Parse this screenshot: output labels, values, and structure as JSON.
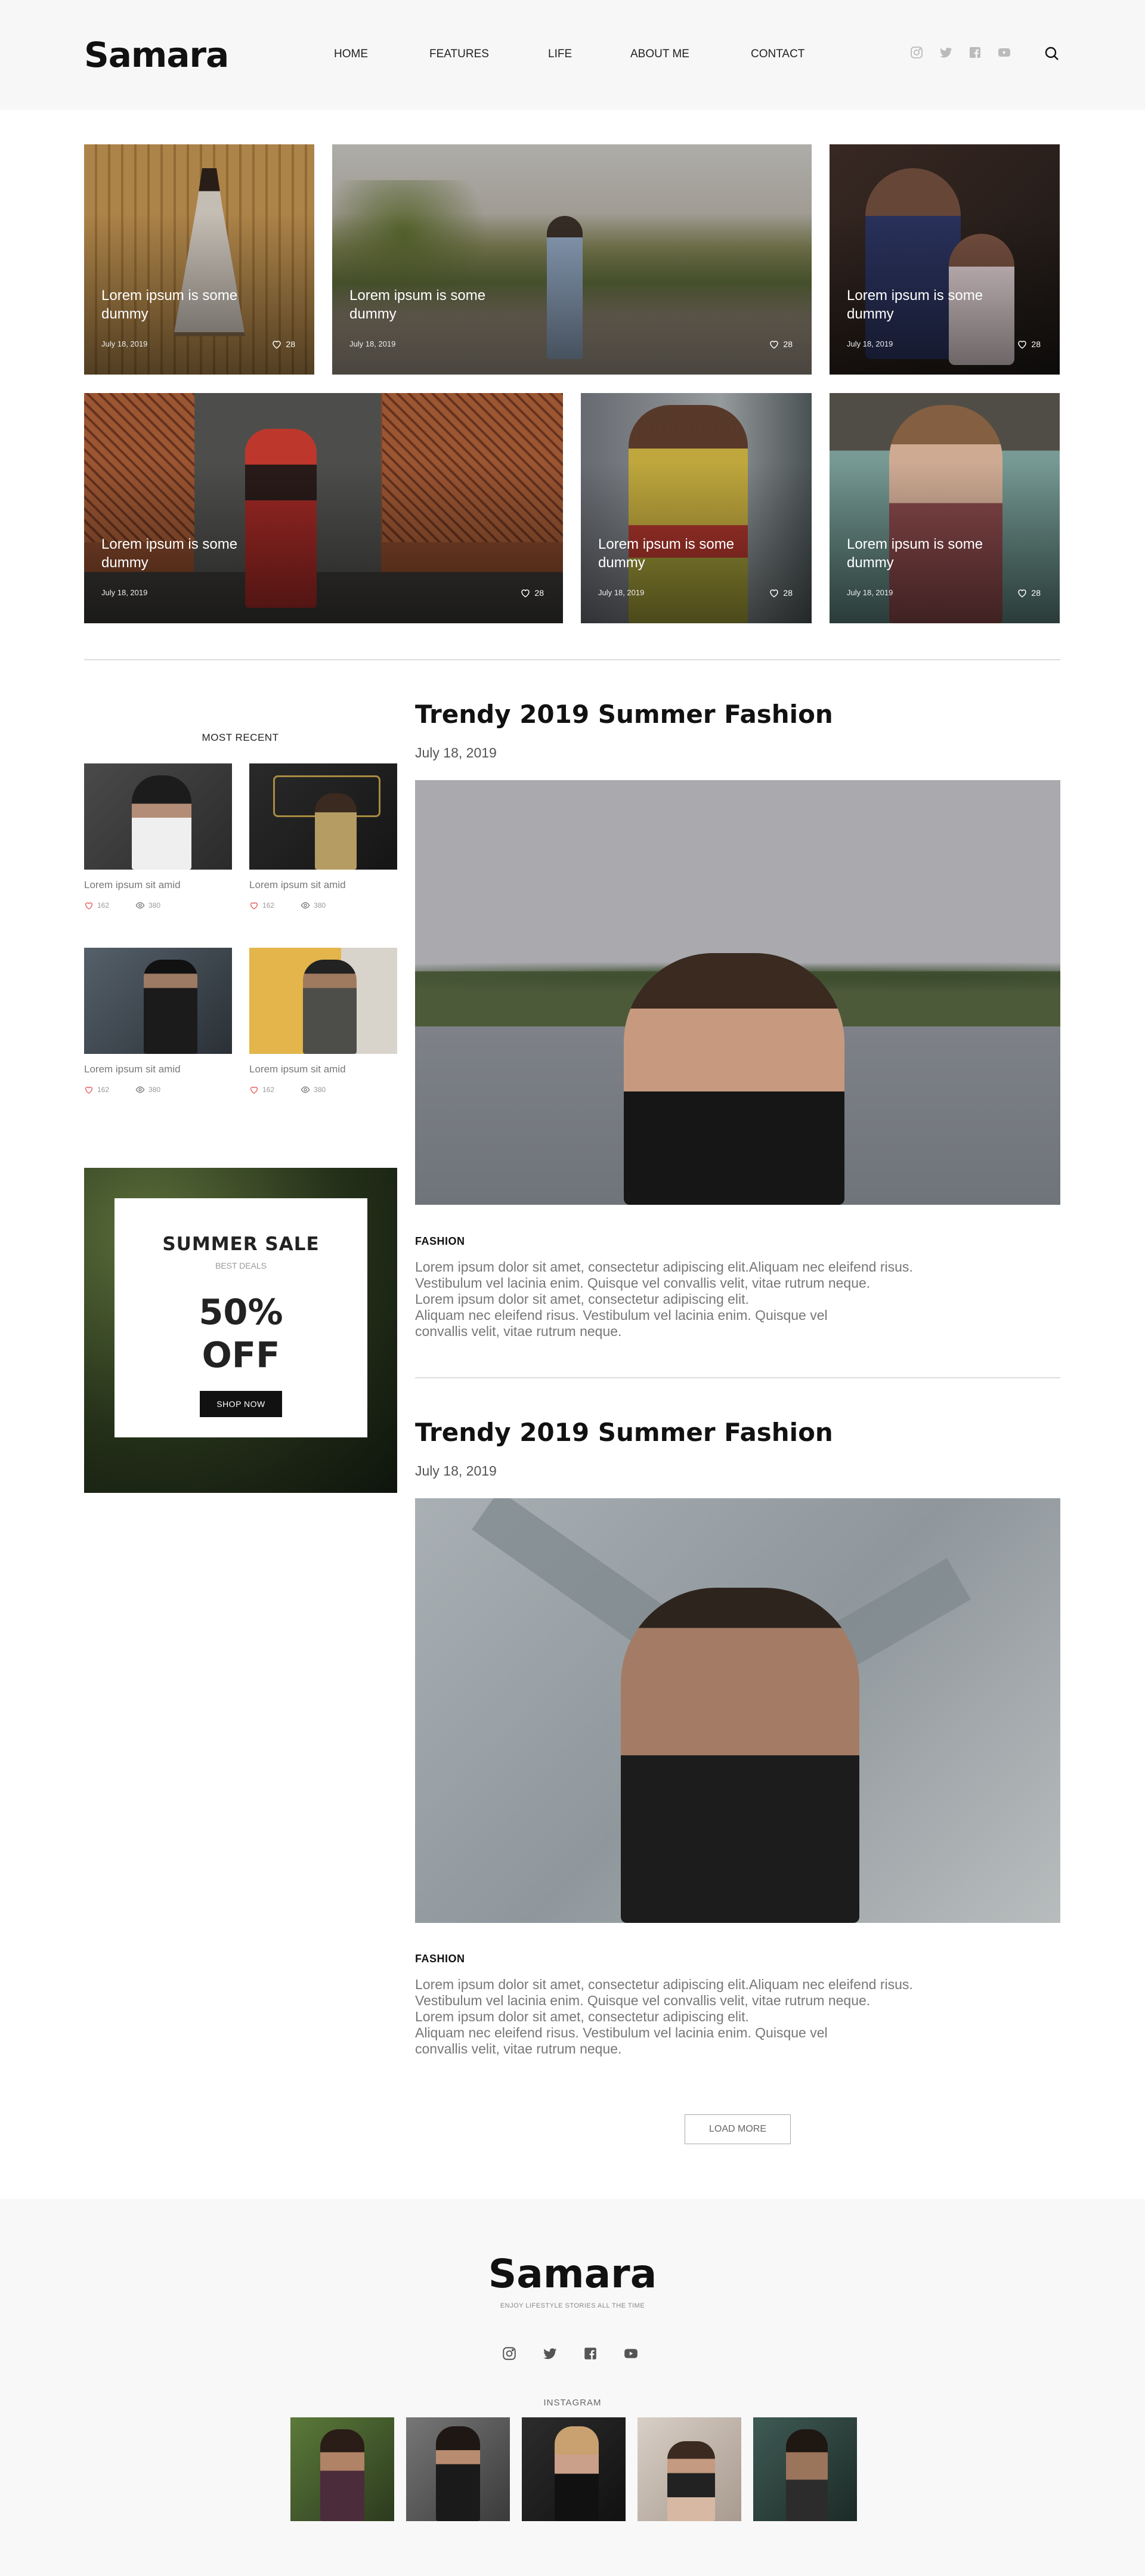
{
  "header": {
    "logo": "Samara",
    "nav": [
      "HOME",
      "FEATURES",
      "LIFE",
      "ABOUT ME",
      "CONTACT"
    ],
    "social": [
      "instagram-icon",
      "twitter-icon",
      "facebook-icon",
      "youtube-icon"
    ]
  },
  "featured": [
    {
      "caption": "Lorem ipsum is some dummy",
      "date": "July 18, 2019",
      "likes": "28"
    },
    {
      "caption": "Lorem ipsum is some dummy",
      "date": "July 18, 2019",
      "likes": "28"
    },
    {
      "caption": "Lorem ipsum is some dummy",
      "date": "July 18, 2019",
      "likes": "28"
    },
    {
      "caption": "Lorem ipsum is some dummy",
      "date": "July 18, 2019",
      "likes": "28"
    },
    {
      "caption": "Lorem ipsum is some dummy",
      "date": "July 18, 2019",
      "likes": "28"
    },
    {
      "caption": "Lorem ipsum is some dummy",
      "date": "July 18, 2019",
      "likes": "28"
    }
  ],
  "sidebar": {
    "title": "MOST RECENT",
    "posts": [
      {
        "caption": "Lorem ipsum sit amid",
        "likes": "162",
        "views": "380"
      },
      {
        "caption": "Lorem ipsum sit amid",
        "likes": "162",
        "views": "380"
      },
      {
        "caption": "Lorem ipsum sit amid",
        "likes": "162",
        "views": "380"
      },
      {
        "caption": "Lorem ipsum sit amid",
        "likes": "162",
        "views": "380"
      }
    ],
    "promo": {
      "title": "SUMMER SALE",
      "subtitle": "BEST DEALS",
      "pct_line1": "50%",
      "pct_line2": "OFF",
      "button": "SHOP NOW"
    }
  },
  "articles": [
    {
      "title": "Trendy 2019 Summer Fashion",
      "date": "July 18, 2019",
      "category": "FASHION",
      "body": [
        "Lorem ipsum dolor sit amet, consectetur adipiscing elit.Aliquam nec eleifend risus.",
        "Vestibulum vel lacinia enim. Quisque vel convallis velit, vitae rutrum neque.",
        "Lorem ipsum dolor sit amet, consectetur adipiscing elit.",
        "Aliquam nec eleifend risus. Vestibulum vel lacinia enim. Quisque vel",
        "convallis velit, vitae rutrum neque."
      ]
    },
    {
      "title": "Trendy 2019 Summer Fashion",
      "date": "July 18, 2019",
      "category": "FASHION",
      "body": [
        "Lorem ipsum dolor sit amet, consectetur adipiscing elit.Aliquam nec eleifend risus.",
        "Vestibulum vel lacinia enim. Quisque vel convallis velit, vitae rutrum neque.",
        "Lorem ipsum dolor sit amet, consectetur adipiscing elit.",
        "Aliquam nec eleifend risus. Vestibulum vel lacinia enim. Quisque vel",
        "convallis velit, vitae rutrum neque."
      ]
    }
  ],
  "load_more": "LOAD MORE",
  "footer": {
    "logo": "Samara",
    "tagline": "ENJOY LIFESTYLE STORIES ALL THE TIME",
    "social": [
      "instagram-icon",
      "twitter-icon",
      "facebook-icon",
      "youtube-icon"
    ],
    "instagram_title": "INSTAGRAM"
  }
}
